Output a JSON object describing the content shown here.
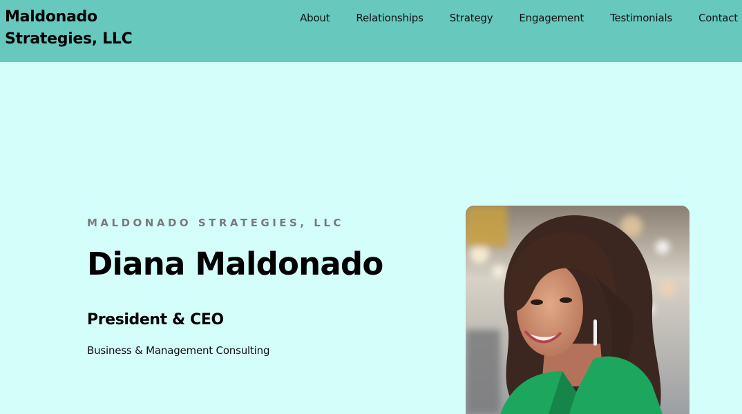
{
  "header": {
    "brand_line1": "Maldonado",
    "brand_line2": "Strategies, LLC",
    "nav": [
      {
        "label": "About"
      },
      {
        "label": "Relationships"
      },
      {
        "label": "Strategy"
      },
      {
        "label": "Engagement"
      },
      {
        "label": "Testimonials"
      },
      {
        "label": "Contact"
      }
    ]
  },
  "hero": {
    "eyebrow": "MALDONADO STRATEGIES, LLC",
    "name": "Diana Maldonado",
    "role": "President & CEO",
    "description": "Business & Management Consulting",
    "portrait_icon": "person-photo"
  },
  "colors": {
    "header_bg": "#67c8be",
    "page_bg": "#d4fefa",
    "eyebrow": "#7a7a7a",
    "shirt": "#1da65e"
  }
}
